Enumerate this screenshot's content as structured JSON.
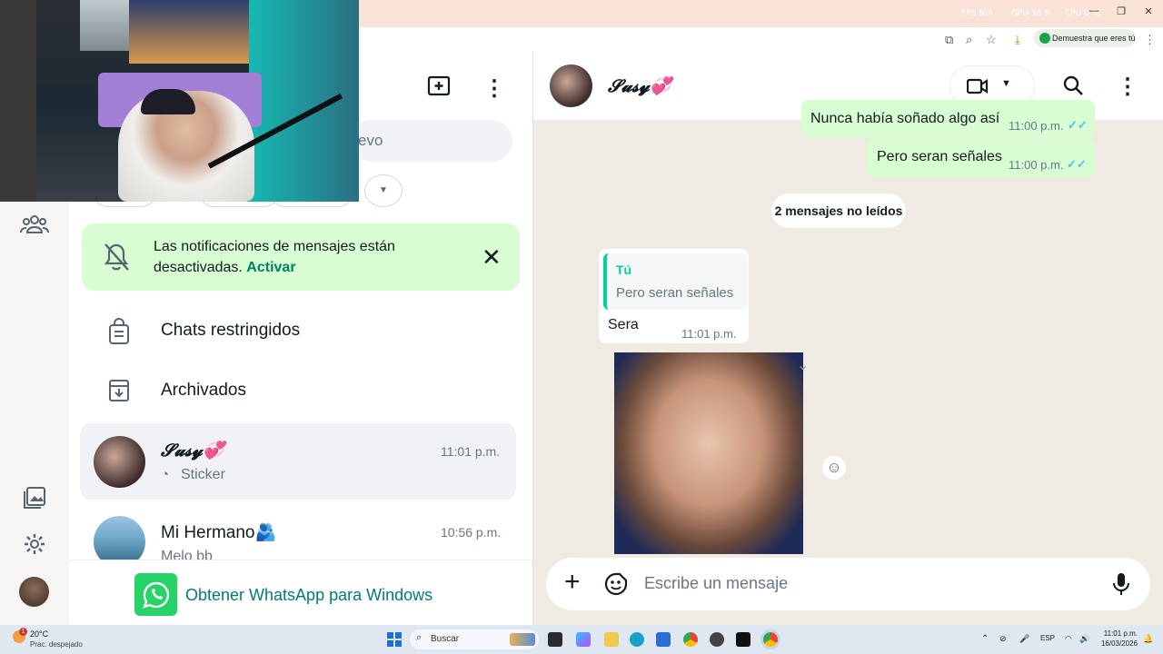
{
  "browser": {
    "top_indicators": [
      "FPS N/A",
      "GPU 36 %",
      "CPU 0 %"
    ],
    "verify_button": "Demuestra que eres tú"
  },
  "sidebar": {
    "search_placeholder": "evo"
  },
  "notification_banner": {
    "text": "Las notificaciones de mensajes están desactivadas.",
    "action": "Activar"
  },
  "chat_list": {
    "restricted": "Chats restringidos",
    "archived": "Archivados",
    "chats": [
      {
        "name": "𝓢𝓾𝓼𝔂💞",
        "time": "11:01 p.m.",
        "preview": "Sticker"
      },
      {
        "name": "Mi Hermano🫂",
        "time": "10:56 p.m.",
        "preview": "Melo bb"
      }
    ],
    "get_app": "Obtener WhatsApp para Windows"
  },
  "chat": {
    "contact_name": "𝓢𝓾𝓼𝔂💞",
    "messages_out": [
      {
        "text": "Nunca había soñado algo así",
        "time": "11:00 p.m."
      },
      {
        "text": "Pero seran señales",
        "time": "11:00 p.m."
      }
    ],
    "unread_divider": "2 mensajes no leídos",
    "reply": {
      "quoted_author": "Tú",
      "quoted_text": "Pero seran señales",
      "text": "Sera",
      "time": "11:01 p.m."
    },
    "composer_placeholder": "Escribe un mensaje"
  },
  "taskbar": {
    "weather_temp": "20°C",
    "weather_desc": "Prac. despejado",
    "weather_badge": "1",
    "search_label": "Buscar",
    "lang": "ESP",
    "clock_time": "11:01 p.m.",
    "clock_date": "16/03/2026"
  },
  "colors": {
    "accent_green": "#008069",
    "bubble_out": "#d9fdd3",
    "chat_bg": "#efeae2",
    "tick_blue": "#53bdeb"
  }
}
